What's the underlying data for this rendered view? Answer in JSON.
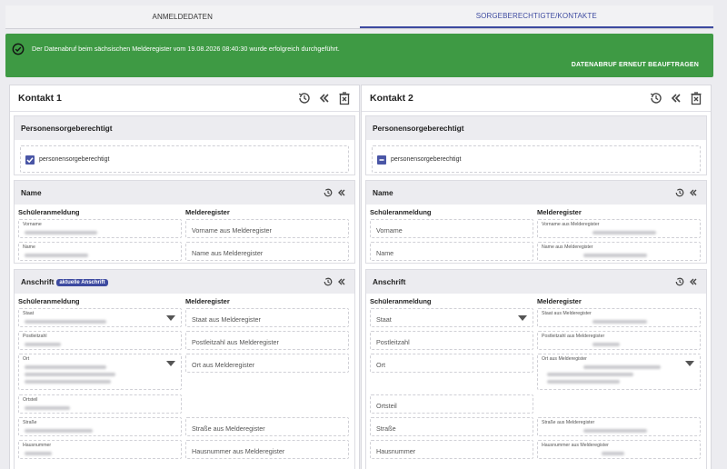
{
  "tabs": [
    {
      "label": "ANMELDEDATEN",
      "active": false
    },
    {
      "label": "SORGEBERECHTIGTE/KONTAKTE",
      "active": true
    }
  ],
  "banner": {
    "message": "Der Datenabruf beim sächsischen Melderegister vom 19.08.2026 08:40:30 wurde erfolgreich durchgeführt.",
    "action": "DATENABRUF ERNEUT BEAUFTRAGEN",
    "color": "#3e9a44"
  },
  "contacts": [
    {
      "title": "Kontakt 1",
      "guardian": {
        "title": "Personensorgeberechtigt",
        "checkbox_label": "personensorgeberechtigt"
      },
      "name": {
        "title": "Name",
        "left_header": "Schüleranmeldung",
        "right_header": "Melderegister",
        "left": [
          "Vorname",
          "Name"
        ],
        "right": [
          "Vorname aus Melderegister",
          "Name aus Melderegister"
        ]
      },
      "address": {
        "title": "Anschrift",
        "badge": "aktuelle Anschrift",
        "left_header": "Schüleranmeldung",
        "right_header": "Melderegister",
        "left": [
          "Staat",
          "Postleitzahl",
          "Ort",
          "Ortsteil",
          "Straße",
          "Hausnummer"
        ],
        "right": [
          "Staat aus Melderegister",
          "Postleitzahl aus Melderegister",
          "Ort aus Melderegister",
          "Straße aus Melderegister",
          "Hausnummer aus Melderegister"
        ]
      }
    },
    {
      "title": "Kontakt 2",
      "guardian": {
        "title": "Personensorgeberechtigt",
        "checkbox_label": "personensorgeberechtigt"
      },
      "name": {
        "title": "Name",
        "left_header": "Schüleranmeldung",
        "right_header": "Melderegister",
        "left": [
          "Vorname",
          "Name"
        ],
        "right": [
          "Vorname aus Melderegister",
          "Name aus Melderegister"
        ]
      },
      "address": {
        "title": "Anschrift",
        "left_header": "Schüleranmeldung",
        "right_header": "Melderegister",
        "left": [
          "Staat",
          "Postleitzahl",
          "Ort",
          "Ortsteil",
          "Straße",
          "Hausnummer"
        ],
        "right": [
          "Staat aus Melderegister",
          "Postleitzahl aus Melderegister",
          "Ort aus Melderegister",
          "Straße aus Melderegister",
          "Hausnummer aus Melderegister"
        ]
      }
    }
  ],
  "colors": {
    "accent": "#3d4aa0",
    "success": "#3e9a44"
  }
}
